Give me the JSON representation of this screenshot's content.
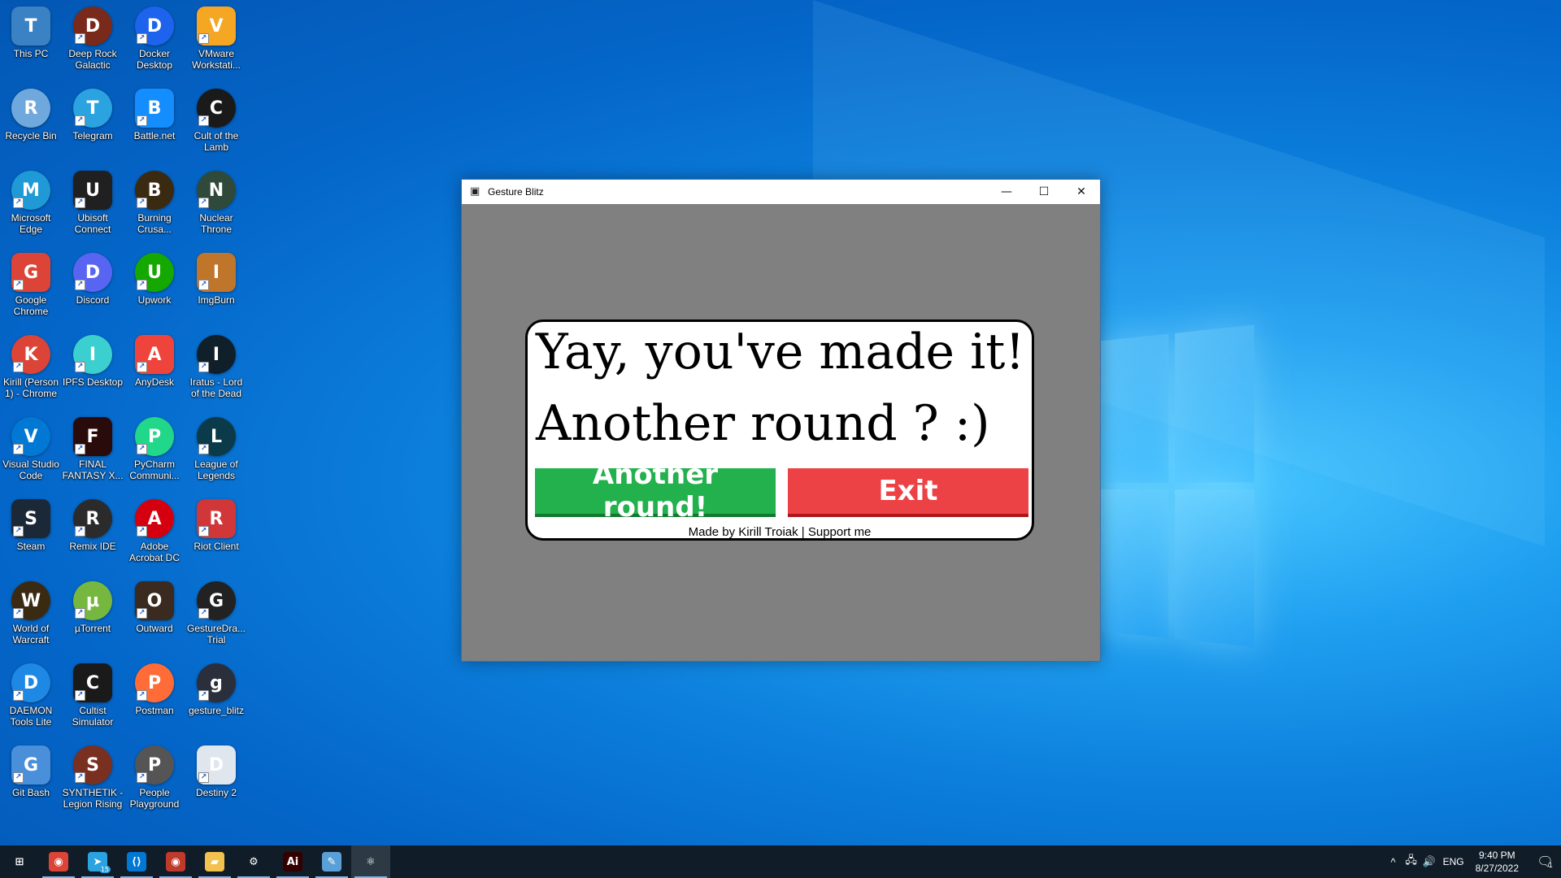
{
  "desktop": {
    "icons": [
      {
        "label": "This PC",
        "icon": "computer-icon",
        "color": "#3b82c4"
      },
      {
        "label": "Deep Rock Galactic",
        "icon": "dwarf-icon",
        "color": "#7a2a1a"
      },
      {
        "label": "Docker Desktop",
        "icon": "whale-icon",
        "color": "#1d63ed"
      },
      {
        "label": "VMware Workstati...",
        "icon": "vmware-icon",
        "color": "#f5a623"
      },
      {
        "label": "Recycle Bin",
        "icon": "recycle-bin-icon",
        "color": "#6fa8dc"
      },
      {
        "label": "Telegram",
        "icon": "paper-plane-icon",
        "color": "#2aa3e0"
      },
      {
        "label": "Battle.net",
        "icon": "battlenet-icon",
        "color": "#148eff"
      },
      {
        "label": "Cult of the Lamb",
        "icon": "lamb-icon",
        "color": "#1a1a1a"
      },
      {
        "label": "Microsoft Edge",
        "icon": "edge-icon",
        "color": "#1f9ad6"
      },
      {
        "label": "Ubisoft Connect",
        "icon": "ubisoft-icon",
        "color": "#202020"
      },
      {
        "label": "Burning Crusa...",
        "icon": "warcraft-icon",
        "color": "#3b2a12"
      },
      {
        "label": "Nuclear Throne",
        "icon": "nuclear-throne-icon",
        "color": "#2f4a3a"
      },
      {
        "label": "Google Chrome",
        "icon": "chrome-icon",
        "color": "#db4437"
      },
      {
        "label": "Discord",
        "icon": "discord-icon",
        "color": "#5865f2"
      },
      {
        "label": "Upwork",
        "icon": "upwork-icon",
        "color": "#14a800"
      },
      {
        "label": "ImgBurn",
        "icon": "disc-fire-icon",
        "color": "#c0762a"
      },
      {
        "label": "Kirill (Person 1) - Chrome",
        "icon": "chrome-profile-icon",
        "color": "#db4437"
      },
      {
        "label": "IPFS Desktop",
        "icon": "cube-icon",
        "color": "#3ccfcf"
      },
      {
        "label": "AnyDesk",
        "icon": "anydesk-icon",
        "color": "#ef443b"
      },
      {
        "label": "Iratus - Lord of the Dead",
        "icon": "skull-icon",
        "color": "#10202a"
      },
      {
        "label": "Visual Studio Code",
        "icon": "vscode-icon",
        "color": "#0078d4"
      },
      {
        "label": "FINAL FANTASY X...",
        "icon": "ffxiv-icon",
        "color": "#2a0b0b"
      },
      {
        "label": "PyCharm Communi...",
        "icon": "pycharm-icon",
        "color": "#21d789"
      },
      {
        "label": "League of Legends",
        "icon": "lol-icon",
        "color": "#0b3a4a"
      },
      {
        "label": "Steam",
        "icon": "steam-icon",
        "color": "#1b2838"
      },
      {
        "label": "Remix IDE",
        "icon": "remix-icon",
        "color": "#2b2b2b"
      },
      {
        "label": "Adobe Acrobat DC",
        "icon": "acrobat-icon",
        "color": "#d4000f"
      },
      {
        "label": "Riot Client",
        "icon": "riot-icon",
        "color": "#d13639"
      },
      {
        "label": "World of Warcraft",
        "icon": "wow-icon",
        "color": "#3b2a12"
      },
      {
        "label": "µTorrent",
        "icon": "utorrent-icon",
        "color": "#76b83f"
      },
      {
        "label": "Outward",
        "icon": "outward-icon",
        "color": "#3a2a20"
      },
      {
        "label": "GestureDra... Trial",
        "icon": "gd-icon",
        "color": "#222222"
      },
      {
        "label": "DAEMON Tools Lite",
        "icon": "daemon-icon",
        "color": "#1e88e5"
      },
      {
        "label": "Cultist Simulator",
        "icon": "cultist-icon",
        "color": "#1a1a1a"
      },
      {
        "label": "Postman",
        "icon": "postman-icon",
        "color": "#ff6c37"
      },
      {
        "label": "gesture_blitz",
        "icon": "electron-icon",
        "color": "#2b2e3b"
      },
      {
        "label": "Git Bash",
        "icon": "git-icon",
        "color": "#4a8fd9"
      },
      {
        "label": "SYNTHETIK - Legion Rising",
        "icon": "synthetik-icon",
        "color": "#7a3020"
      },
      {
        "label": "People Playground",
        "icon": "people-playground-icon",
        "color": "#555555"
      },
      {
        "label": "Destiny 2",
        "icon": "destiny-icon",
        "color": "#e0e6ee"
      }
    ]
  },
  "window": {
    "title": "Gesture Blitz",
    "app_icon": "gesture-blitz-app-icon",
    "minimize_glyph": "—",
    "maximize_glyph": "☐",
    "close_glyph": "✕"
  },
  "dialog": {
    "line1": "Yay, you've made it!",
    "line2": "Another round ? :)",
    "another_round_label": "Another round!",
    "exit_label": "Exit",
    "credit_prefix": "Made by Kirill Troiak | ",
    "support_link": "Support me",
    "green_color": "#22b14c",
    "red_color": "#ed4245"
  },
  "taskbar": {
    "items": [
      {
        "icon": "windows-start-icon",
        "glyph": "⊞",
        "color": "#101c27"
      },
      {
        "icon": "chrome-taskbar-icon",
        "glyph": "◉",
        "color": "#db4437"
      },
      {
        "icon": "telegram-taskbar-icon",
        "glyph": "➤",
        "color": "#2aa3e0",
        "badge": "15"
      },
      {
        "icon": "vscode-taskbar-icon",
        "glyph": "⟨⟩",
        "color": "#0078d4"
      },
      {
        "icon": "chrome-profile-taskbar-icon",
        "glyph": "◉",
        "color": "#c03a2b"
      },
      {
        "icon": "file-explorer-taskbar-icon",
        "glyph": "▰",
        "color": "#f2c14e"
      },
      {
        "icon": "settings-taskbar-icon",
        "glyph": "⚙",
        "color": "#101c27"
      },
      {
        "icon": "illustrator-taskbar-icon",
        "glyph": "Ai",
        "color": "#330000"
      },
      {
        "icon": "paint-taskbar-icon",
        "glyph": "✎",
        "color": "#5aa0d8"
      },
      {
        "icon": "gesture-blitz-taskbar-icon",
        "glyph": "⚛",
        "color": "#2d3a45"
      }
    ],
    "tray": {
      "chevron": "^",
      "network": "🖧",
      "volume": "🔊",
      "language": "ENG",
      "time": "9:40 PM",
      "date": "8/27/2022",
      "notification_count": "1"
    }
  }
}
